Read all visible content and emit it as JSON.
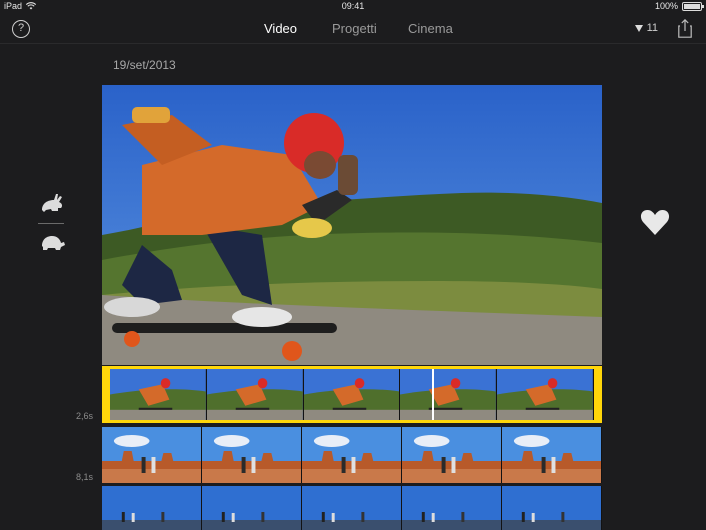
{
  "status_bar": {
    "device": "iPad",
    "time": "09:41",
    "battery": "100%",
    "battery_level": 1.0
  },
  "nav": {
    "help": "?",
    "tabs": [
      {
        "label": "Video",
        "active": true
      },
      {
        "label": "Progetti",
        "active": false
      },
      {
        "label": "Cinema",
        "active": false
      }
    ],
    "filter_count": "11"
  },
  "date": "19/set/2013",
  "speed_controls": {
    "fast_icon": "rabbit-icon",
    "slow_icon": "turtle-icon"
  },
  "favorite_icon": "heart-icon",
  "clips": [
    {
      "duration": "2,6s",
      "selected": true,
      "scene": "skate"
    },
    {
      "duration": "8,1s",
      "selected": false,
      "scene": "desert"
    },
    {
      "duration": "",
      "selected": false,
      "scene": "blue"
    }
  ],
  "colors": {
    "accent": "#ffd60a",
    "background": "#1c1c1e",
    "sky": "#2f6fd1"
  }
}
